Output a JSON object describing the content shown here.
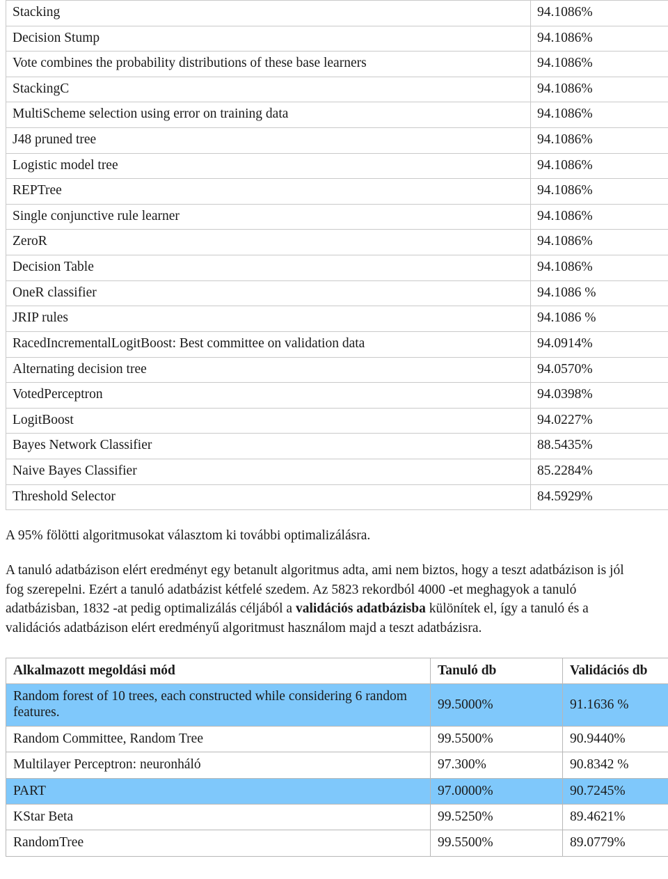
{
  "colors": {
    "highlight": "#7fc8fb",
    "table_border": "#c9c9c9",
    "text": "#1a1a1a"
  },
  "results_table": {
    "rows": [
      {
        "name": "Stacking",
        "value": "94.1086%"
      },
      {
        "name": "Decision Stump",
        "value": "94.1086%"
      },
      {
        "name": "Vote combines the probability distributions of these base learners",
        "value": "94.1086%"
      },
      {
        "name": "StackingC",
        "value": "94.1086%"
      },
      {
        "name": "MultiScheme selection using error on training data",
        "value": "94.1086%"
      },
      {
        "name": "J48 pruned tree",
        "value": "94.1086%"
      },
      {
        "name": "Logistic model tree",
        "value": "94.1086%"
      },
      {
        "name": "REPTree",
        "value": "94.1086%"
      },
      {
        "name": "Single conjunctive rule learner",
        "value": "94.1086%"
      },
      {
        "name": "ZeroR",
        "value": "94.1086%"
      },
      {
        "name": "Decision Table",
        "value": "94.1086%"
      },
      {
        "name": "OneR classifier",
        "value": "94.1086 %"
      },
      {
        "name": "JRIP rules",
        "value": "94.1086 %"
      },
      {
        "name": "RacedIncrementalLogitBoost: Best committee on validation data",
        "value": "94.0914%"
      },
      {
        "name": "Alternating decision tree",
        "value": "94.0570%"
      },
      {
        "name": "VotedPerceptron",
        "value": "94.0398%"
      },
      {
        "name": "LogitBoost",
        "value": "94.0227%"
      },
      {
        "name": "Bayes Network Classifier",
        "value": "88.5435%"
      },
      {
        "name": "Naive Bayes Classifier",
        "value": "85.2284%"
      },
      {
        "name": "Threshold Selector",
        "value": "84.5929%"
      }
    ]
  },
  "paragraphs": {
    "intro": "A 95% fölötti algoritmusokat választom ki további optimalizálásra.",
    "body_part1": "A tanuló adatbázison elért eredményt egy betanult algoritmus adta, ami nem biztos, hogy a teszt adatbázison is jól fog szerepelni. Ezért a tanuló adatbázist kétfelé szedem. Az 5823 rekordból 4000 -et meghagyok a tanuló adatbázisban, 1832 -at pedig optimalizálás céljából a ",
    "body_bold": "validációs adatbázisba",
    "body_part2": " különítek el, így a tanuló és a validációs adatbázison elért eredményű algoritmust használom majd a teszt adatbázisra."
  },
  "chosen_table": {
    "headers": {
      "method": "Alkalmazott megoldási mód",
      "train": "Tanuló db",
      "validation": "Validációs db"
    },
    "rows": [
      {
        "method": "Random forest of 10 trees, each constructed while considering 6 random features.",
        "train": "99.5000%",
        "validation": "91.1636 %",
        "highlighted": true
      },
      {
        "method": "Random Committee, Random Tree",
        "train": "99.5500%",
        "validation": "90.9440%",
        "highlighted": false
      },
      {
        "method": "Multilayer Perceptron: neuronháló",
        "train": "97.300%",
        "validation": "90.8342 %",
        "highlighted": false
      },
      {
        "method": "PART",
        "train": "97.0000%",
        "validation": "90.7245%",
        "highlighted": true
      },
      {
        "method": "KStar Beta",
        "train": "99.5250%",
        "validation": "89.4621%",
        "highlighted": false
      },
      {
        "method": "RandomTree",
        "train": "99.5500%",
        "validation": "89.0779%",
        "highlighted": false
      }
    ]
  }
}
